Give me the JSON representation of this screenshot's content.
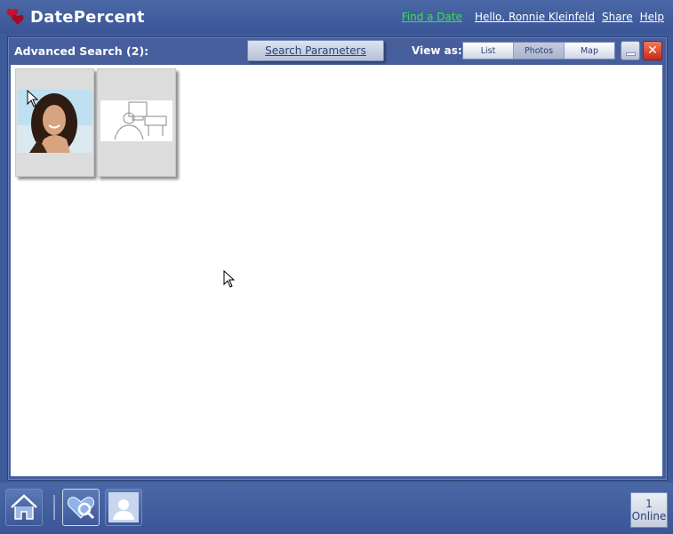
{
  "app": {
    "title": "DatePercent"
  },
  "header": {
    "find_date": "Find a Date",
    "greeting": "Hello, Ronnie Kleinfeld",
    "share": "Share",
    "help": "Help"
  },
  "panel": {
    "title": "Advanced Search (2):",
    "search_parameters": "Search Parameters",
    "view_as_label": "View as:",
    "view_options": [
      "List",
      "Photos",
      "Map"
    ],
    "selected_view": "Photos",
    "close_glyph": "✕"
  },
  "results": [
    {
      "kind": "photo",
      "icon": "woman-photo"
    },
    {
      "kind": "placeholder",
      "icon": "no-photo-placeholder"
    }
  ],
  "footer": {
    "online_count": "1",
    "online_label": "Online"
  },
  "colors": {
    "bar": "#3d5a99",
    "find_link": "#39e24b",
    "close": "#cc2a12"
  }
}
